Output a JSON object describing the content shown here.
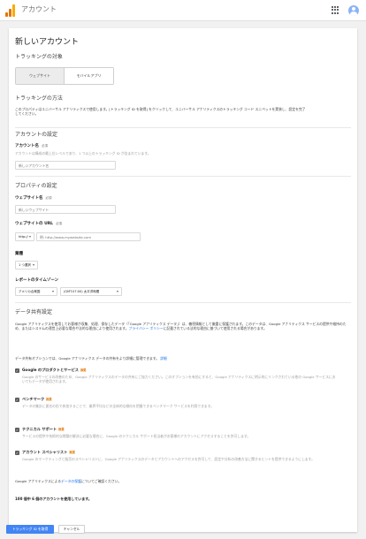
{
  "appbar": {
    "title": "アカウント",
    "logo_colors": [
      "#f9ab00",
      "#e37400",
      "#e37400"
    ]
  },
  "page": {
    "title": "新しいアカウント"
  },
  "tracking_target": {
    "heading": "トラッキングの対象",
    "options": [
      "ウェブサイト",
      "モバイルアプリ"
    ],
    "selected": "ウェブサイト"
  },
  "tracking_method": {
    "heading": "トラッキングの方法",
    "text": "このプロパティはユニバーサル アナリティクスで使用します。[トラッキング ID を取得] をクリックして、ユニバーサル アナリティクスのトラッキング コード スニペットを実装し、設定を完了してください。"
  },
  "account": {
    "heading": "アカウントの設定",
    "name_label": "アカウント名",
    "required": "必須",
    "name_help": "アカウントは構成の最上位レベルであり、1 つ以上のトラッキング ID が含まれています。",
    "name_placeholder": "新しいアカウント名"
  },
  "property": {
    "heading": "プロパティの設定",
    "site_name_label": "ウェブサイト名",
    "site_name_placeholder": "新しいウェブサイト",
    "site_url_label": "ウェブサイトの URL",
    "protocol": "http://",
    "url_placeholder": "例: http://www.mywebsite.com",
    "industry_label": "業種",
    "industry_value": "1 つ選択",
    "timezone_label": "レポートのタイムゾーン",
    "country_value": "アメリカ合衆国",
    "timezone_value": "(GMT-07:00) 太平洋時間"
  },
  "data_sharing": {
    "heading": "データ共有設定",
    "intro": "Google アナリティクスを使用してお客様が収集、処理、保存したデータ（「Google アナリティクス データ」）は、機密情報として厳重に保護されます。このデータは、Google アナリティクス サービスの提供や維持のため、またはシステムの運営上必要な場合や法的な理由により使用されます。",
    "intro_link": "プライバシー ポリシー",
    "intro_tail": "に記載されている法的な理由に基づいて使用される場合があります。",
    "options_text": "データ共有オプションでは、Google アナリティクス データの共有をより詳細に管理できます。",
    "options_link": "詳細",
    "badge": "推奨",
    "items": [
      {
        "title": "Google のプロダクトとサービス",
        "desc": "Google のサービスの改善のため、Google アナリティクスのデータの共有にご協力ください。このオプションを有効にすると、Google アナリティクスに明示的にリンクされている他の Google サービスにおいてもデータが使用されます。"
      },
      {
        "title": "ベンチマーク",
        "desc": "データの集計に匿名の形で参加することで、業界平均などの全体的な傾向を把握できるベンチマーク サービスを利用できます。"
      },
      {
        "title": "テクニカル サポート",
        "desc": "サービスの提供や技術的な問題の解決に必要な場合に、Google のテクニカル サポート担当者がお客様のアカウントにアクセスすることを許可します。"
      },
      {
        "title": "アカウント スペシャリスト",
        "desc": "Google のマーケティングと販売のスペシャリストに、Google アナリティクスのデータとアカウントへのアクセスを許可して、設定や分析の改善方法に関するヒントを提供できるようにします。"
      }
    ],
    "footer": "Google アナリティクスによる",
    "footer_link": "データの保護",
    "footer_tail": "についてご確認ください。"
  },
  "usage": {
    "text": "100 個中 6 個のアカウントを使用しています。"
  },
  "actions": {
    "submit": "トラッキング ID を取得",
    "cancel": "キャンセル"
  }
}
